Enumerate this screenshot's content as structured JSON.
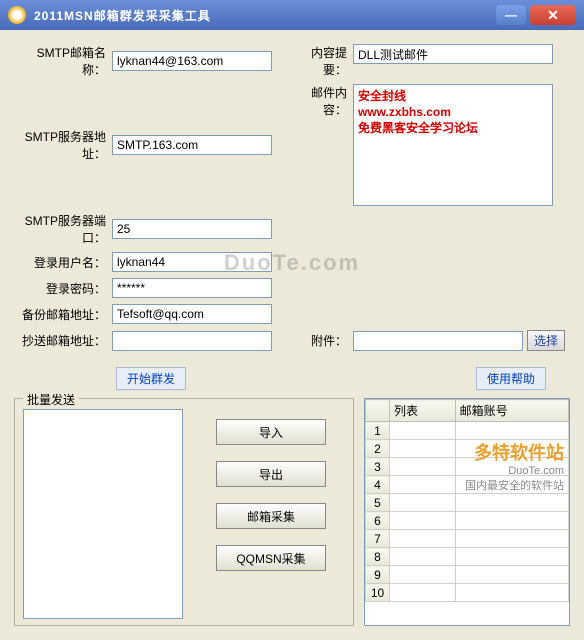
{
  "window": {
    "title": "2011MSN邮箱群发采采集工具"
  },
  "form": {
    "smtp_name_label": "SMTP邮箱名称：",
    "smtp_name_value": "lyknan44@163.com",
    "smtp_server_label": "SMTP服务器地址：",
    "smtp_server_value": "SMTP.163.com",
    "smtp_port_label": "SMTP服务器端口：",
    "smtp_port_value": "25",
    "login_user_label": "登录用户名：",
    "login_user_value": "lyknan44",
    "login_pass_label": "登录密码：",
    "login_pass_value": "******",
    "backup_label": "备份邮箱地址：",
    "backup_value": "Tefsoft@qq.com",
    "cc_label": "抄送邮箱地址：",
    "cc_value": "",
    "summary_label": "内容提要：",
    "summary_value": "DLL测试邮件",
    "content_label": "邮件内容：",
    "content_lines": {
      "l1": "安全封线",
      "l2": "www.zxbhs.com",
      "l3": "免费黑客安全学习论坛"
    },
    "attach_label": "附件：",
    "attach_value": "",
    "attach_select": "选择"
  },
  "actions": {
    "start": "开始群发",
    "help": "使用帮助"
  },
  "batch": {
    "legend": "批量发送",
    "import": "导入",
    "export": "导出",
    "collect_mail": "邮箱采集",
    "collect_qqmsn": "QQMSN采集"
  },
  "table": {
    "col_list": "列表",
    "col_account": "邮箱账号",
    "rows": [
      "1",
      "2",
      "3",
      "4",
      "5",
      "6",
      "7",
      "8",
      "9",
      "10"
    ]
  },
  "watermark": {
    "center": "DuoTe.com",
    "brand": "多特软件站",
    "url": "DuoTe.com",
    "slogan": "国内最安全的软件站"
  }
}
